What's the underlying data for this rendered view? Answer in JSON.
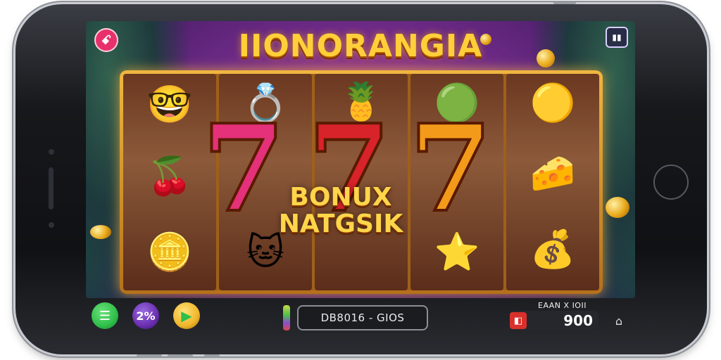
{
  "game": {
    "title": "IIONORANGIA",
    "bonus_line1": "BONUX",
    "bonus_line2": "NATGSIK",
    "big_symbols": [
      "7",
      "7",
      "7"
    ]
  },
  "header": {
    "logo_glyph": "ꗃ",
    "stats_glyph": "▮▮"
  },
  "controls": {
    "menu_glyph": "☰",
    "percent_label": "2%",
    "play_glyph": "▶",
    "bet_display": "DB8016 - GIOS",
    "win_label": "EAAN X IOII",
    "win_value": "900",
    "win_icon_glyph": "◧",
    "settings_glyph": "⌂"
  },
  "colors": {
    "title_gold": "#ffcf3a",
    "seven_left": "#e5307a",
    "seven_mid": "#d8232a",
    "seven_right": "#f39a1a",
    "btn_green": "#2fbf4a",
    "btn_purple": "#6a2fb0",
    "win_red": "#d9302b"
  }
}
